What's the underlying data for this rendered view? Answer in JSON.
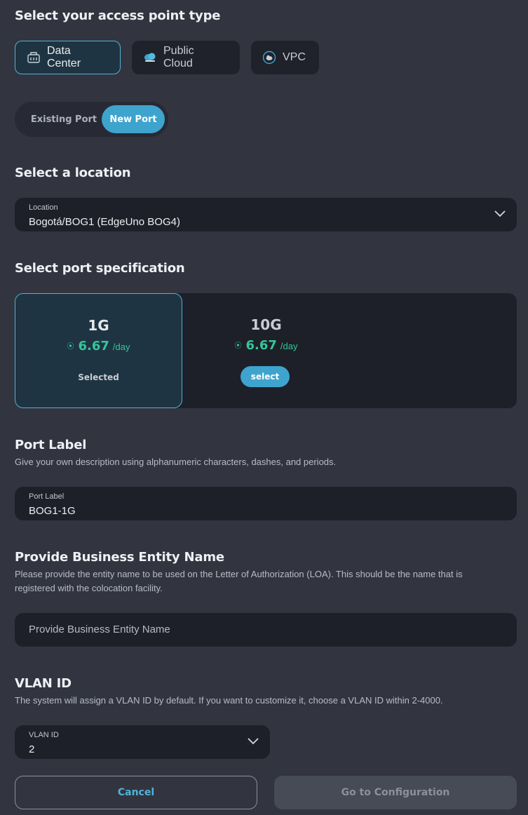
{
  "access_point": {
    "title": "Select your access point type",
    "options": [
      {
        "label": "Data Center",
        "icon": "building-icon",
        "active": true
      },
      {
        "label": "Public Cloud",
        "icon": "cloud-icon",
        "active": false
      },
      {
        "label": "VPC",
        "icon": "vpc-cloud-icon",
        "active": false
      }
    ]
  },
  "port_toggle": {
    "existing": "Existing Port",
    "new": "New Port",
    "selected": "New Port"
  },
  "location": {
    "title": "Select a location",
    "field_label": "Location",
    "value": "Bogotá/BOG1 (EdgeUno BOG4)"
  },
  "port_spec": {
    "title": "Select port specification",
    "options": [
      {
        "name": "1G",
        "price": "6.67",
        "unit": "/day",
        "state": "Selected"
      },
      {
        "name": "10G",
        "price": "6.67",
        "unit": "/day",
        "button": "select"
      }
    ]
  },
  "port_label": {
    "title": "Port Label",
    "description": "Give your own description using alphanumeric characters, dashes, and periods.",
    "field_label": "Port Label",
    "value": "BOG1-1G"
  },
  "business_entity": {
    "title": "Provide Business Entity Name",
    "description_line1": "Please provide the entity name to be used on the Letter of Authorization (LOA). This should be the name that is",
    "description_line2": "registered with the colocation facility.",
    "placeholder": "Provide Business Entity Name"
  },
  "vlan": {
    "title": "VLAN ID",
    "description": "The system will assign a VLAN ID by default. If you want to customize it, choose a VLAN ID within 2-4000.",
    "field_label": "VLAN ID",
    "value": "2"
  },
  "actions": {
    "cancel": "Cancel",
    "go": "Go to Configuration"
  },
  "colors": {
    "accent": "#3ea4cd",
    "price": "#34c69a",
    "background": "#32353f",
    "field": "#1d2029"
  }
}
